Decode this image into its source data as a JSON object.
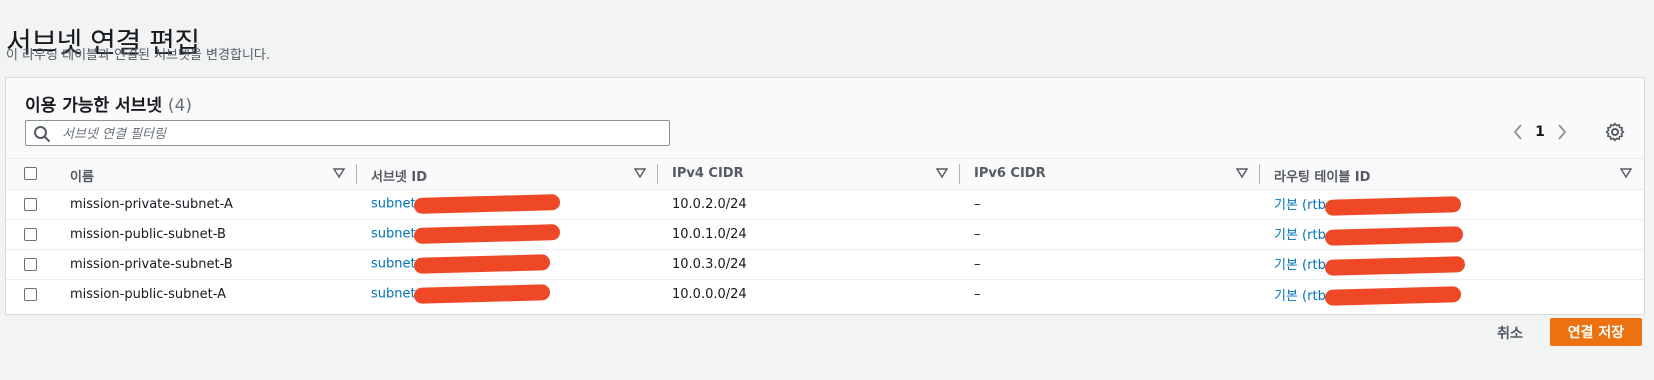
{
  "page": {
    "title": "서브넷 연결 편집",
    "description": "이 라우팅 테이블과 연결된 서브넷을 변경합니다."
  },
  "panel": {
    "title": "이용 가능한 서브넷",
    "count": "(4)",
    "search_placeholder": "서브넷 연결 필터링",
    "pagination": {
      "current_page": "1"
    }
  },
  "table": {
    "columns": [
      "이름",
      "서브넷 ID",
      "IPv4 CIDR",
      "IPv6 CIDR",
      "라우팅 테이블 ID"
    ],
    "rows": [
      {
        "name": "mission-private-subnet-A",
        "subnet_id": "subnet-",
        "ipv4": "10.0.2.0/24",
        "ipv6": "–",
        "route_table": "기본 (rtb-"
      },
      {
        "name": "mission-public-subnet-B",
        "subnet_id": "subnet-",
        "ipv4": "10.0.1.0/24",
        "ipv6": "–",
        "route_table": "기본 (rtb-"
      },
      {
        "name": "mission-private-subnet-B",
        "subnet_id": "subnet-",
        "ipv4": "10.0.3.0/24",
        "ipv6": "–",
        "route_table": "기본 (rtb-"
      },
      {
        "name": "mission-public-subnet-A",
        "subnet_id": "subnet-",
        "ipv4": "10.0.0.0/24",
        "ipv6": "–",
        "route_table": "기본 (rtb-"
      }
    ]
  },
  "buttons": {
    "cancel": "취소",
    "save": "연결 저장"
  },
  "colors": {
    "primary": "#ec7211",
    "link": "#0073bb",
    "redaction": "#ef4826"
  },
  "icons": [
    "search-icon",
    "chevron-left-icon",
    "chevron-right-icon",
    "gear-icon",
    "sort-icon"
  ]
}
